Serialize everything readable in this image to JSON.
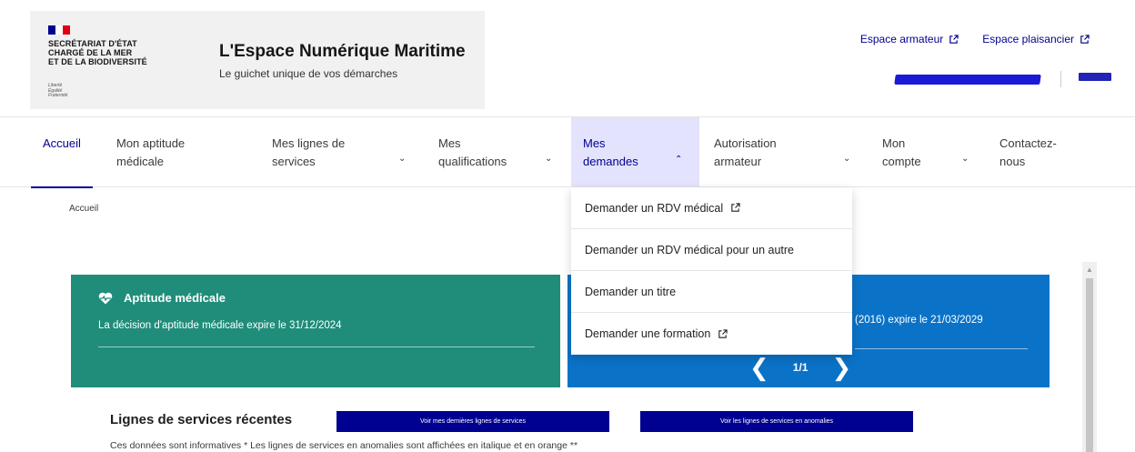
{
  "brand": {
    "ministry_lines": "SECRÉTARIAT D'ÉTAT\nCHARGÉ DE LA MER\nET DE LA BIODIVERSITÉ",
    "devise": "Liberté\nÉgalité\nFraternité",
    "site_title": "L'Espace Numérique Maritime",
    "tagline": "Le guichet unique de vos démarches",
    "flag_colors": [
      "#000091",
      "#ffffff",
      "#e1000f"
    ]
  },
  "top_links": [
    {
      "label": "Espace armateur",
      "icon": "external-link-icon"
    },
    {
      "label": "Espace plaisancier",
      "icon": "external-link-icon"
    }
  ],
  "nav": {
    "items": [
      {
        "label": "Accueil",
        "state": "current"
      },
      {
        "label": "Mon aptitude\nmédicale"
      },
      {
        "label": "Mes lignes de\nservices",
        "has_submenu": true
      },
      {
        "label": "Mes\nqualifications",
        "has_submenu": true
      },
      {
        "label": "Mes\ndemandes",
        "has_submenu": true,
        "state": "open"
      },
      {
        "label": "Autorisation\narmateur",
        "has_submenu": true
      },
      {
        "label": "Mon\ncompte",
        "has_submenu": true
      },
      {
        "label": "Contactez-\nnous"
      }
    ]
  },
  "dropdown": {
    "items": [
      {
        "label": "Demander un RDV médical",
        "external": true
      },
      {
        "label": "Demander un RDV médical pour un autre"
      },
      {
        "label": "Demander un titre"
      },
      {
        "label": "Demander une formation",
        "external": true
      }
    ]
  },
  "breadcrumb": "Accueil",
  "cards": {
    "medical": {
      "title": "Aptitude médicale",
      "description": "La décision d'aptitude médicale expire le 31/12/2024",
      "icon": "heart-pulse-icon",
      "color": "#1f8d7a"
    },
    "qualification": {
      "description": "(2016) expire le 21/03/2029",
      "page_indicator": "1/1",
      "color": "#0a73c8"
    }
  },
  "recent": {
    "title": "Lignes de services récentes",
    "btn_last": "Voir mes dernières lignes de services",
    "btn_anomalies": "Voir les lignes de services en anomalies",
    "info": "Ces données sont informatives * Les lignes de services en anomalies sont affichées en italique et en orange **"
  },
  "colors": {
    "accent": "#000091",
    "nav_open_bg": "#e3e3fd"
  }
}
